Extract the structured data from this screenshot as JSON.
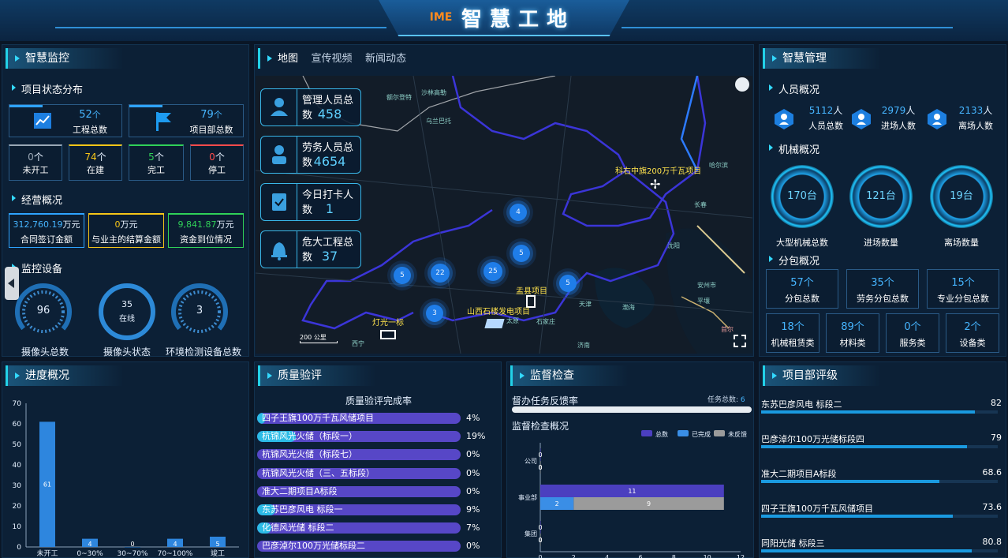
{
  "header": {
    "logo": "IME",
    "title": "智慧工地"
  },
  "monitor": {
    "title": "智慧监控",
    "project_status": {
      "title": "项目状态分布",
      "total": {
        "value": "52",
        "unit": "个",
        "label": "工程总数"
      },
      "dept": {
        "value": "79",
        "unit": "个",
        "label": "项目部总数"
      },
      "states": [
        {
          "value": "0",
          "unit": "个",
          "label": "未开工",
          "color": "#9aa7b5"
        },
        {
          "value": "74",
          "unit": "个",
          "label": "在建",
          "color": "#f5c518"
        },
        {
          "value": "5",
          "unit": "个",
          "label": "完工",
          "color": "#30d158"
        },
        {
          "value": "0",
          "unit": "个",
          "label": "停工",
          "color": "#ff4b4b"
        }
      ]
    },
    "business": {
      "title": "经营概况",
      "items": [
        {
          "value": "312,760.19",
          "unit": "万元",
          "label": "合同签订金额",
          "color": "#46b5ff"
        },
        {
          "value": "0",
          "unit": "万元",
          "label": "与业主的结算金额",
          "color": "#f5c518"
        },
        {
          "value": "9,841.87",
          "unit": "万元",
          "label": "资金到位情况",
          "color": "#30d158"
        }
      ]
    },
    "devices": {
      "title": "监控设备",
      "items": [
        {
          "value": "96",
          "sub": "",
          "label": "摄像头总数"
        },
        {
          "value": "35",
          "sub": "在线",
          "label": "摄像头状态"
        },
        {
          "value": "3",
          "sub": "",
          "label": "环境检测设备总数"
        }
      ]
    }
  },
  "map": {
    "tabs": [
      "地图",
      "宣传视频",
      "新闻动态"
    ],
    "stats": [
      {
        "label": "管理人员总数",
        "value": "458"
      },
      {
        "label": "劳务人员总数",
        "value": "4654"
      },
      {
        "label": "今日打卡人数",
        "value": "1"
      },
      {
        "label": "危大工程总数",
        "value": "37"
      }
    ],
    "projects": [
      "科右中旗200万千瓦项目",
      "盂县项目",
      "山西石楼发电项目",
      "灯光一标"
    ],
    "clusters": [
      "4",
      "5",
      "22",
      "25",
      "5",
      "3",
      "5"
    ],
    "places": [
      "哈尔滨",
      "长春",
      "沈阳",
      "天津",
      "渤海",
      "石家庄",
      "太原",
      "济南",
      "西宁",
      "乌兰巴托",
      "额尔登特",
      "沙林高勒",
      "安州市",
      "平壤",
      "首尔"
    ],
    "scale": "200 公里"
  },
  "manage": {
    "title": "智慧管理",
    "people": {
      "title": "人员概况",
      "items": [
        {
          "value": "5112",
          "unit": "人",
          "label": "人员总数"
        },
        {
          "value": "2979",
          "unit": "人",
          "label": "进场人数"
        },
        {
          "value": "2133",
          "unit": "人",
          "label": "离场人数"
        }
      ]
    },
    "machine": {
      "title": "机械概况",
      "items": [
        {
          "value": "170台",
          "label": "大型机械总数"
        },
        {
          "value": "121台",
          "label": "进场数量"
        },
        {
          "value": "19台",
          "label": "离场数量"
        }
      ]
    },
    "sub": {
      "title": "分包概况",
      "row1": [
        {
          "value": "57个",
          "label": "分包总数"
        },
        {
          "value": "35个",
          "label": "劳务分包总数"
        },
        {
          "value": "15个",
          "label": "专业分包总数"
        }
      ],
      "row2": [
        {
          "value": "18个",
          "label": "机械租赁类"
        },
        {
          "value": "89个",
          "label": "材料类"
        },
        {
          "value": "0个",
          "label": "服务类"
        },
        {
          "value": "2个",
          "label": "设备类"
        }
      ]
    }
  },
  "progress": {
    "title": "进度概况"
  },
  "quality": {
    "title": "质量验评",
    "subtitle": "质量验评完成率",
    "rows": [
      {
        "name": "四子王旗100万千瓦风储项目",
        "pct": "4%",
        "v": 4
      },
      {
        "name": "杭锦风光火储（标段一）",
        "pct": "19%",
        "v": 19
      },
      {
        "name": "杭锦风光火储（标段七）",
        "pct": "0%",
        "v": 0
      },
      {
        "name": "杭锦风光火储（三、五标段）",
        "pct": "0%",
        "v": 0
      },
      {
        "name": "准大二期项目A标段",
        "pct": "0%",
        "v": 0
      },
      {
        "name": "东苏巴彦风电 标段一",
        "pct": "9%",
        "v": 9
      },
      {
        "name": "化德风光储 标段二",
        "pct": "7%",
        "v": 7
      },
      {
        "name": "巴彦淖尔100万光储标段二",
        "pct": "0%",
        "v": 0
      }
    ]
  },
  "supervise": {
    "title": "监督检查",
    "feedback_label": "督办任务反馈率",
    "task_total_label": "任务总数:",
    "task_total": "6",
    "overview_label": "监督检查概况",
    "legend": [
      "总数",
      "已完成",
      "未反馈"
    ]
  },
  "rating": {
    "title": "项目部评级",
    "items": [
      {
        "name": "东苏巴彦风电 标段二",
        "score": "82",
        "v": 82
      },
      {
        "name": "巴彦淖尔100万光储标段四",
        "score": "79",
        "v": 79
      },
      {
        "name": "准大二期项目A标段",
        "score": "68.6",
        "v": 68.6
      },
      {
        "name": "四子王旗100万千瓦风储项目",
        "score": "73.6",
        "v": 73.6
      },
      {
        "name": "同阳光储 标段三",
        "score": "80.8",
        "v": 80.8
      }
    ]
  },
  "chart_data": [
    {
      "type": "bar",
      "title": "",
      "categories": [
        "未开工",
        "0~30%",
        "30~70%",
        "70~100%",
        "竣工"
      ],
      "values": [
        61,
        4,
        0,
        4,
        5
      ],
      "ylim": [
        0,
        70
      ],
      "yticks": [
        0,
        10,
        20,
        30,
        40,
        50,
        60,
        70
      ],
      "color": "#2e86de"
    },
    {
      "type": "bar",
      "orientation": "horizontal",
      "categories": [
        "公司",
        "事业部",
        "集团"
      ],
      "series": [
        {
          "name": "总数",
          "values": [
            0,
            11,
            0
          ],
          "color": "#4b3fbf"
        },
        {
          "name": "已完成",
          "values": [
            0,
            2,
            0
          ],
          "color": "#3a8ee6"
        },
        {
          "name": "未反馈",
          "values": [
            0,
            9,
            0
          ],
          "color": "#9b9b9b"
        }
      ],
      "xlim": [
        0,
        12
      ],
      "xticks": [
        0,
        2,
        4,
        6,
        8,
        10,
        12
      ]
    }
  ]
}
